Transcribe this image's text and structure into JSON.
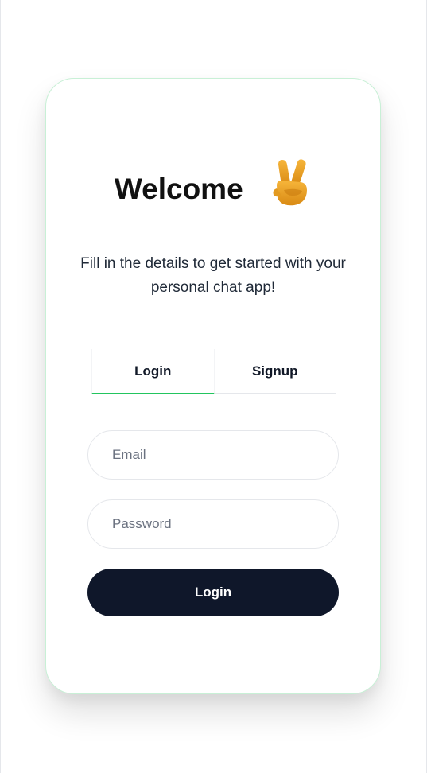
{
  "card": {
    "title": "Welcome",
    "title_icon": "victory-hand-icon",
    "subtitle": "Fill in the details to get started with your personal chat app!"
  },
  "tabs": [
    {
      "label": "Login",
      "active": true
    },
    {
      "label": "Signup",
      "active": false
    }
  ],
  "form": {
    "email_placeholder": "Email",
    "email_value": "",
    "password_placeholder": "Password",
    "password_value": "",
    "submit_label": "Login"
  },
  "colors": {
    "accent": "#22c55e",
    "button": "#0f172a",
    "card_border": "#c8f0d6"
  }
}
